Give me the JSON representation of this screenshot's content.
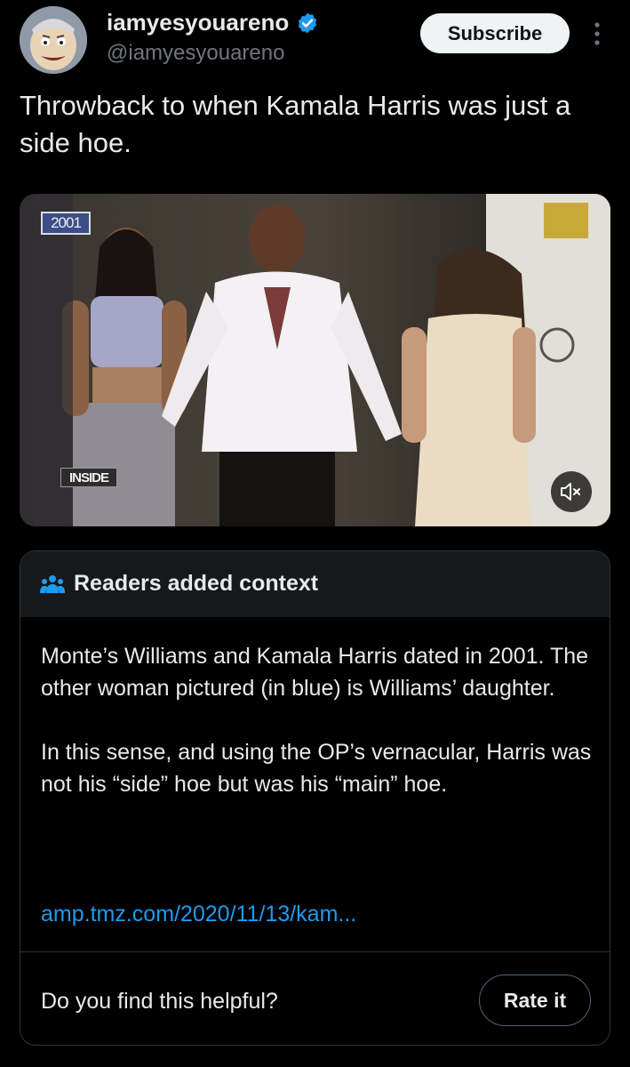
{
  "author": {
    "display_name": "iamyesyouareno",
    "handle": "@iamyesyouareno",
    "avatar_icon": "cartoon-face-avatar",
    "verified_icon": "verified-badge-icon",
    "verified_color": "#1d9bf0"
  },
  "header": {
    "subscribe_label": "Subscribe",
    "more_icon": "more-vertical-icon"
  },
  "tweet": {
    "text": "Throwback to when Kamala Harris was just a side hoe."
  },
  "media": {
    "year_badge": "2001",
    "show_badge": "INSIDE",
    "mute_icon": "speaker-muted-icon"
  },
  "note": {
    "header_icon": "people-icon",
    "title": "Readers added context",
    "paragraphs": [
      "Monte’s Williams and Kamala Harris dated in 2001. The other woman pictured (in blue) is Williams’ daughter.",
      "In this sense, and using the OP’s vernacular, Harris was not his “side” hoe but was his “main” hoe."
    ],
    "link": "amp.tmz.com/2020/11/13/kam...",
    "helpful_question": "Do you find this helpful?",
    "rate_label": "Rate it",
    "link_color": "#1d9bf0"
  }
}
